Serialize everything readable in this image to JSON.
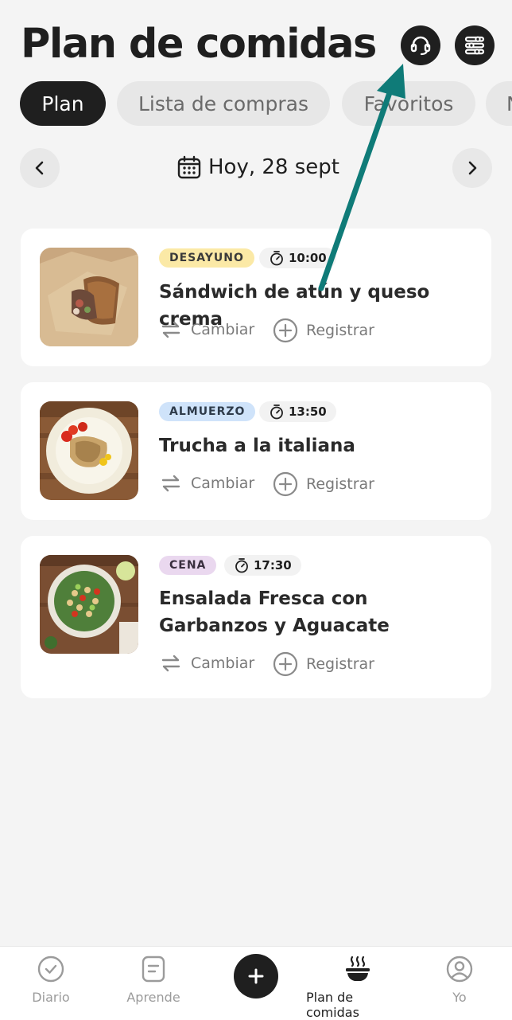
{
  "header": {
    "title": "Plan de comidas",
    "support_icon": "headset-icon",
    "filter_icon": "sliders-icon"
  },
  "tabs": [
    {
      "label": "Plan",
      "active": true
    },
    {
      "label": "Lista de compras",
      "active": false
    },
    {
      "label": "Favoritos",
      "active": false
    },
    {
      "label": "N",
      "active": false
    }
  ],
  "date_nav": {
    "label": "Hoy, 28 sept",
    "prev_icon": "chevron-left-icon",
    "next_icon": "chevron-right-icon",
    "calendar_icon": "calendar-icon"
  },
  "meals": [
    {
      "badge": "DESAYUNO",
      "badge_bg": "#fbe9a6",
      "time": "10:00",
      "name": "Sándwich de atún y queso crema",
      "change_label": "Cambiar",
      "log_label": "Registrar"
    },
    {
      "badge": "ALMUERZO",
      "badge_bg": "#cfe3fa",
      "time": "13:50",
      "name": "Trucha a la italiana",
      "change_label": "Cambiar",
      "log_label": "Registrar"
    },
    {
      "badge": "CENA",
      "badge_bg": "#ead8ef",
      "time": "17:30",
      "name": "Ensalada Fresca con Garbanzos y Aguacate",
      "change_label": "Cambiar",
      "log_label": "Registrar"
    }
  ],
  "bottom_nav": {
    "diary": "Diario",
    "learn": "Aprende",
    "add_icon": "plus-icon",
    "meal_plan": "Plan de comidas",
    "me": "Yo"
  },
  "colors": {
    "dark": "#1f1f1f",
    "background": "#f4f4f4",
    "arrow": "#0f7b78"
  }
}
